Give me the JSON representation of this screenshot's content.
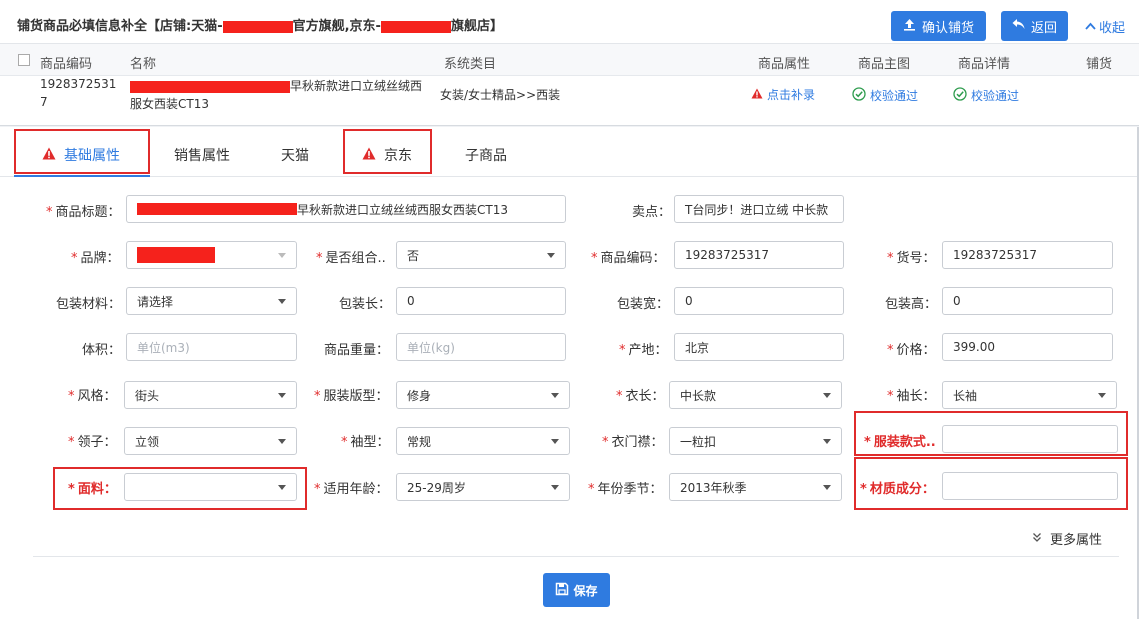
{
  "header": {
    "title_prefix": "铺货商品必填信息补全【店铺:天猫-",
    "title_mid": "官方旗舰,京东-",
    "title_suffix": "旗舰店】",
    "confirm_label": "确认铺货",
    "back_label": "返回",
    "collapse_label": "收起"
  },
  "table": {
    "headers": {
      "code": "商品编码",
      "name": "名称",
      "category": "系统类目",
      "attrs": "商品属性",
      "main_image": "商品主图",
      "detail": "商品详情",
      "distribute": "铺货"
    },
    "row": {
      "code_line1": "1928372531",
      "code_line2": "7",
      "name_line1": "早秋新款进口立绒丝绒西",
      "name_line2": "服女西装CT13",
      "category": "女装/女士精品>>西装",
      "attrs_link": "点击补录",
      "main_image_status": "校验通过",
      "detail_status": "校验通过"
    }
  },
  "tabs": [
    "基础属性",
    "销售属性",
    "天猫",
    "京东",
    "子商品"
  ],
  "form": {
    "title_label": "商品标题：",
    "title_value": "早秋新款进口立绒丝绒西服女西装CT13",
    "selling_label": "卖点：",
    "selling_value": "T台同步！进口立绒 中长款",
    "brand_label": "品牌：",
    "combo_label": "是否组合..",
    "combo_value": "否",
    "code_label": "商品编码：",
    "code_value": "19283725317",
    "sku_label": "货号：",
    "sku_value": "19283725317",
    "pack_material_label": "包装材料：",
    "pack_material_value": "请选择",
    "pack_len_label": "包装长：",
    "pack_len_value": "0",
    "pack_w_label": "包装宽：",
    "pack_w_value": "0",
    "pack_h_label": "包装高：",
    "pack_h_value": "0",
    "volume_label": "体积：",
    "volume_placeholder": "单位(m3)",
    "weight_label": "商品重量：",
    "weight_placeholder": "单位(kg)",
    "origin_label": "产地：",
    "origin_value": "北京",
    "price_label": "价格：",
    "price_value": "399.00",
    "style_label": "风格：",
    "style_value": "街头",
    "fit_label": "服装版型：",
    "fit_value": "修身",
    "length_label": "衣长：",
    "length_value": "中长款",
    "sleeve_label": "袖长：",
    "sleeve_value": "长袖",
    "collar_label": "领子：",
    "collar_value": "立领",
    "sleeve_type_label": "袖型：",
    "sleeve_type_value": "常规",
    "placket_label": "衣门襟：",
    "placket_value": "一粒扣",
    "garment_style_label": "服装款式..",
    "fabric_label": "面料：",
    "age_label": "适用年龄：",
    "age_value": "25-29周岁",
    "season_label": "年份季节：",
    "season_value": "2013年秋季",
    "material_label": "材质成分："
  },
  "more_label": "更多属性",
  "save_label": "保存",
  "colors": {
    "accent": "#2f7be0",
    "alert": "#e02b2b",
    "success": "#2e9c4e"
  }
}
